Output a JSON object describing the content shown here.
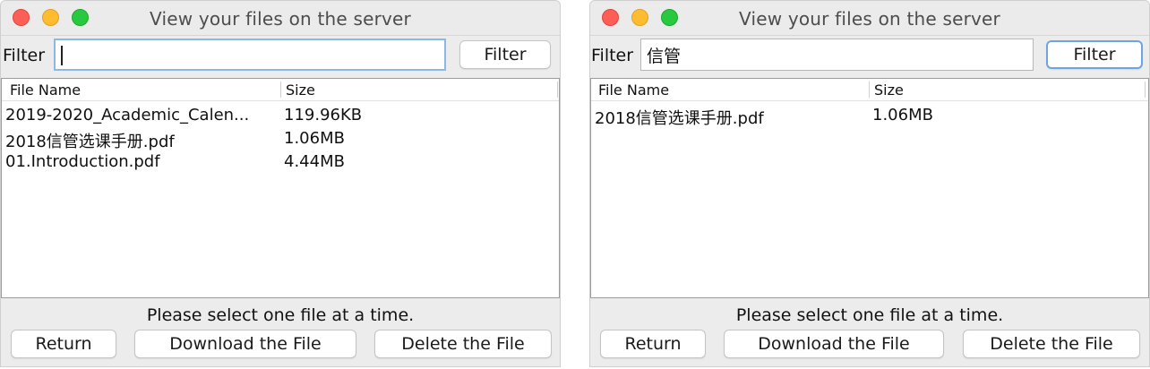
{
  "windows": [
    {
      "title": "View your files on the server",
      "filter": {
        "label": "Filter",
        "value": "",
        "button_label": "Filter"
      },
      "table": {
        "columns": [
          "File Name",
          "Size"
        ],
        "rows": [
          {
            "name": "2019-2020_Academic_Calen...",
            "size": "119.96KB"
          },
          {
            "name": "2018信管选课手册.pdf",
            "size": "1.06MB"
          },
          {
            "name": "01.Introduction.pdf",
            "size": "4.44MB"
          }
        ]
      },
      "status": "Please select one file at a time.",
      "buttons": {
        "return": "Return",
        "download": "Download the File",
        "delete": "Delete the File"
      }
    },
    {
      "title": "View your files on the server",
      "filter": {
        "label": "Filter",
        "value": "信管",
        "button_label": "Filter"
      },
      "table": {
        "columns": [
          "File Name",
          "Size"
        ],
        "rows": [
          {
            "name": "2018信管选课手册.pdf",
            "size": "1.06MB"
          }
        ]
      },
      "status": "Please select one file at a time.",
      "buttons": {
        "return": "Return",
        "download": "Download the File",
        "delete": "Delete the File"
      }
    }
  ]
}
